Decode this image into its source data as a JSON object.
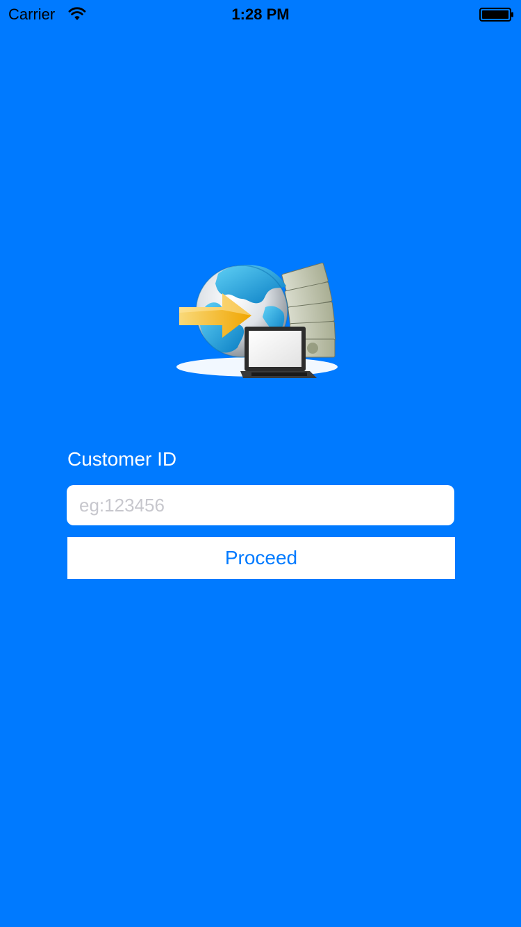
{
  "status_bar": {
    "carrier": "Carrier",
    "time": "1:28 PM"
  },
  "hero_image": {
    "icon": "globe-money-laptop-transfer-icon"
  },
  "form": {
    "customer_id_label": "Customer ID",
    "customer_id_placeholder": "eg:123456",
    "customer_id_value": "",
    "proceed_label": "Proceed"
  },
  "colors": {
    "background": "#007AFF",
    "button_text": "#007AFF",
    "field_background": "#FFFFFF",
    "placeholder": "#C7C7CD"
  }
}
